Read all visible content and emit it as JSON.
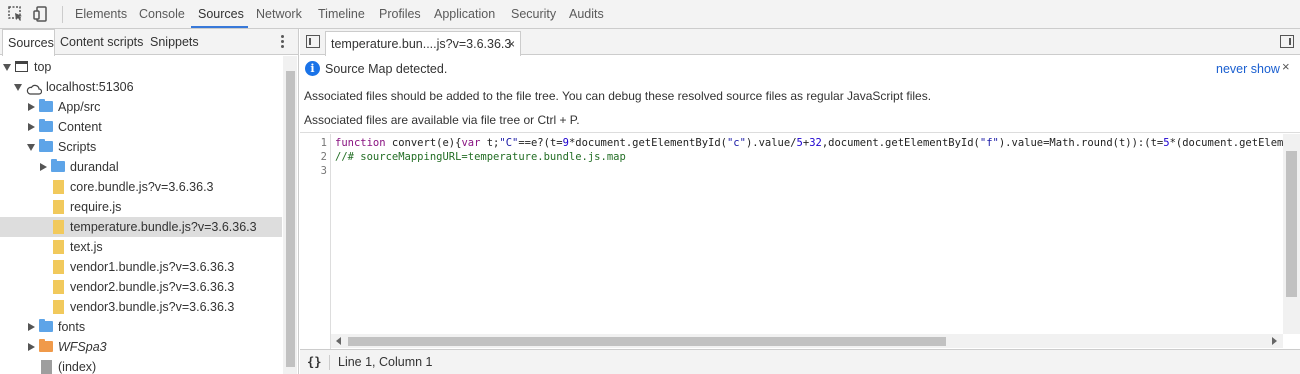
{
  "toolbar": {
    "icons": [
      "inspect-element-icon",
      "device-toolbar-icon"
    ],
    "tabs": [
      "Elements",
      "Console",
      "Sources",
      "Network",
      "Timeline",
      "Profiles",
      "Application",
      "Security",
      "Audits"
    ],
    "active_tab": "Sources",
    "accent_color": "#3879d9"
  },
  "navigator": {
    "tabs": [
      "Sources",
      "Content scripts",
      "Snippets"
    ],
    "active_tab": "Sources",
    "tree": {
      "top": "top",
      "host": "localhost:51306",
      "app_src": "App/src",
      "content": "Content",
      "scripts": "Scripts",
      "durandal": "durandal",
      "core": "core.bundle.js?v=3.6.36.3",
      "require": "require.js",
      "temperature": "temperature.bundle.js?v=3.6.36.3",
      "text": "text.js",
      "vendor1": "vendor1.bundle.js?v=3.6.36.3",
      "vendor2": "vendor2.bundle.js?v=3.6.36.3",
      "vendor3": "vendor3.bundle.js?v=3.6.36.3",
      "fonts": "fonts",
      "wfspa": "WFSpa3",
      "index": "(index)"
    },
    "selected_item": "temperature.bundle.js?v=3.6.36.3"
  },
  "editor": {
    "open_tab": "temperature.bun....js?v=3.6.36.3",
    "close_glyph": "×",
    "infobar": {
      "title": "Source Map detected.",
      "never_show": "never show",
      "close_glyph": "×",
      "line1": "Associated files should be added to the file tree. You can debug these resolved source files as regular JavaScript files.",
      "line2": "Associated files are available via file tree or Ctrl + P."
    },
    "line_numbers": [
      "1",
      "2",
      "3"
    ],
    "code": {
      "l1_kw1": "function",
      "l1_a": " convert(e){",
      "l1_kw2": "var",
      "l1_b": " t;",
      "l1_s1": "\"C\"",
      "l1_c": "==e?(t=",
      "l1_n1": "9",
      "l1_d": "*document.getElementById(",
      "l1_s2": "\"c\"",
      "l1_e": ").value/",
      "l1_n2": "5",
      "l1_f": "+",
      "l1_n3": "32",
      "l1_g": ",document.getElementById(",
      "l1_s3": "\"f\"",
      "l1_h": ").value=Math.round(t)):(t=",
      "l1_n4": "5",
      "l1_i": "*(document.getElementById(",
      "line2": "//# sourceMappingURL=temperature.bundle.js.map"
    },
    "status": {
      "pretty_print": "{}",
      "position": "Line 1, Column 1"
    }
  }
}
